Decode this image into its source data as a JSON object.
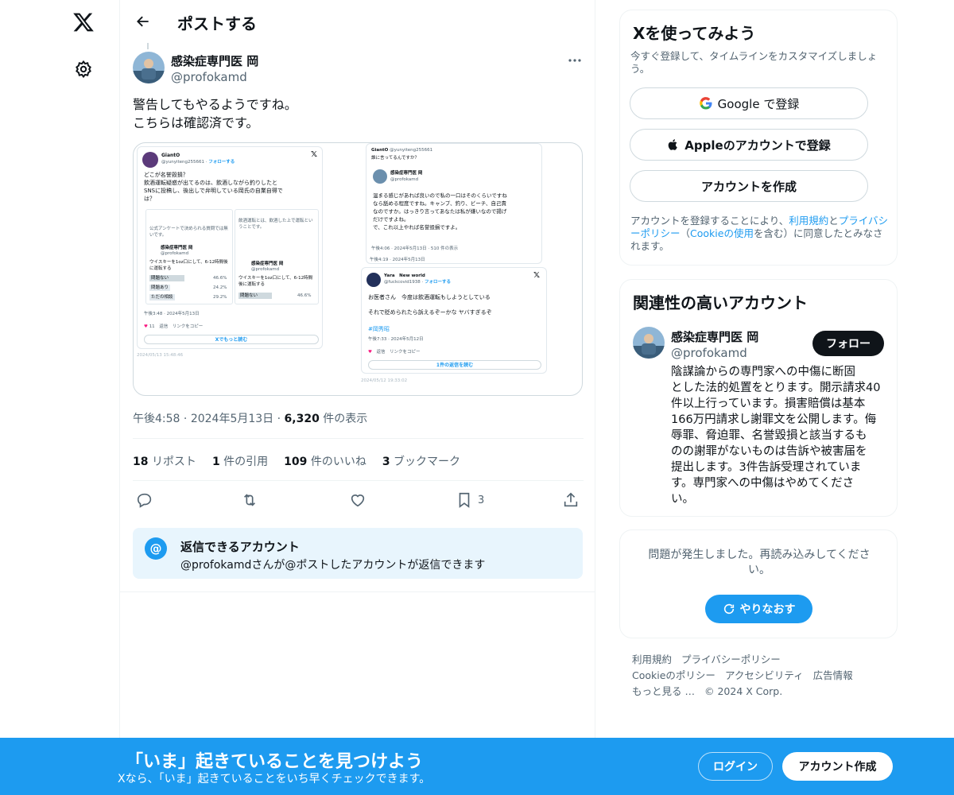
{
  "nav": {
    "logo_icon": "x-logo-icon",
    "settings_icon": "gear-icon"
  },
  "header": {
    "title": "ポストする"
  },
  "post": {
    "author_name": "感染症専門医 岡",
    "author_handle": "@profokamd",
    "text_line1": "警告してもやるようですね。",
    "text_line2": "こちらは確認済です。",
    "time": "午後4:58",
    "date": "2024年5月13日",
    "views": "6,320",
    "views_label": "件の表示",
    "reposts": "18",
    "reposts_label": "リポスト",
    "quotes": "1",
    "quotes_label": "件の引用",
    "likes": "109",
    "likes_label": "件のいいね",
    "bookmarks": "3",
    "bookmarks_label": "ブックマーク",
    "bookmark_count": "3"
  },
  "media": {
    "left_card": {
      "name": "GiantO",
      "handle": "@yunyiteng255661",
      "follow": "フォローする",
      "text_l1": "どこが名誉毀損？",
      "text_l2": "飲酒運転疑惑が出てるのは、飲酒しながら釣りしたと",
      "text_l3": "SNSに投稿し、後出しで弁明している岡氏の自業自得で",
      "text_l4": "は？",
      "inner_a": "公式アンケートで決められる質問では無いです。",
      "inner_b": "飲酒運転とは、飲酒した上で運転ということです。",
      "inner_c": "感染症専門医 岡",
      "inner_d": "@profokamd",
      "inner_e": "ウイスキーを1oz口にして、6-12時間後に運転する",
      "poll_1": "問題ない",
      "poll_1v": "46.6%",
      "poll_2": "問題あり",
      "poll_2v": "24.2%",
      "poll_3": "ただの相談",
      "poll_3v": "29.2%",
      "stamp": "午後3:48 · 2024年5月13日",
      "likes": "11",
      "reply": "返信",
      "copy": "リンクをコピー",
      "readmore": "Xでもっと読む",
      "capture": "2024/05/13 15:48:46"
    },
    "right_top": {
      "name": "GiantO",
      "handle": "@yunyiteng255661",
      "ref": "誰に言ってるんですか？",
      "inner_name": "感染症専門医 岡",
      "inner_handle": "@profokamd",
      "t1": "温まる感じがあれば良いので私の一口はそのくらいですね",
      "t2": "なら舐める程度ですね。キャンプ、釣り、ビーチ、自己責",
      "t3": "なのですか。はっきり言ってあなたは私が嫌いなので揚げ",
      "t4": "だけですよね。",
      "t5": "で、これ以上やれば名誉毀損ですよ。",
      "stamp": "午後4:06 · 2024年5月13日 · 510 件の表示",
      "stamp2": "午後4:19 · 2024年5月13日"
    },
    "right_bottom": {
      "name": "Yara　New world",
      "handle": "@fuckcovid1938",
      "follow": "フォローする",
      "t1": "お医者さん　今度は飲酒運転もしようとしている",
      "t2": "それで貶められたら訴えるぞーかな ヤバすぎるぞ",
      "hashtag": "#岡秀昭",
      "stamp": "午後7:33 · 2024年5月12日",
      "reply": "返信",
      "copy": "リンクをコピー",
      "readmore": "1件の返信を読む",
      "capture": "2024/05/12 19:33:02"
    }
  },
  "reply_restriction": {
    "title": "返信できるアカウント",
    "desc": "@profokamdさんが@ポストしたアカウントが返信できます"
  },
  "signup": {
    "title": "Xを使ってみよう",
    "desc_l1": "今すぐ登録して、タイムラインをカスタマイズしましょ",
    "desc_l2": "う。",
    "google": "Google で登録",
    "apple": "Appleのアカウントで登録",
    "create": "アカウントを作成",
    "legal_1": "アカウントを登録することにより、",
    "legal_terms": "利用規約",
    "legal_and": "と",
    "legal_privacy": "プライバシーポリシー",
    "legal_paren": "（",
    "legal_cookie": "Cookieの使用",
    "legal_2": "を含む）に同意したとみなされます。"
  },
  "related": {
    "title": "関連性の高いアカウント",
    "name": "感染症専門医 岡",
    "handle": "@profokamd",
    "follow": "フォロー",
    "bio_lines": [
      "陰謀論からの専門家への中傷に断固",
      "とした法的処置をとります。開示請求40",
      "件以上行っています。損害賠償は基本",
      "166万円請求し謝罪文を公開します。侮",
      "辱罪、脅迫罪、名誉毀損と該当するも",
      "のの謝罪がないものは告訴や被害届を",
      "提出します。3件告訴受理されていま",
      "す。専門家への中傷はやめてくださ",
      "い。"
    ]
  },
  "error_card": {
    "line1": "問題が発生しました。再読み込みしてくださ",
    "line2": "い。",
    "retry": "やりなおす"
  },
  "footer": {
    "terms": "利用規約",
    "privacy": "プライバシーポリシー",
    "cookie": "Cookieのポリシー",
    "accessibility": "アクセシビリティ",
    "ads": "広告情報",
    "more": "もっと見る …",
    "copyright": "© 2024 X Corp."
  },
  "bottom_bar": {
    "title": "「いま」起きていることを見つけよう",
    "subtitle": "Xなら、「いま」起きていることをいち早くチェックできます。",
    "login": "ログイン",
    "signup": "アカウント作成"
  },
  "colors": {
    "accent": "#1d9bf0",
    "text": "#0f1419",
    "muted": "#536471",
    "border": "#eff3f4"
  }
}
